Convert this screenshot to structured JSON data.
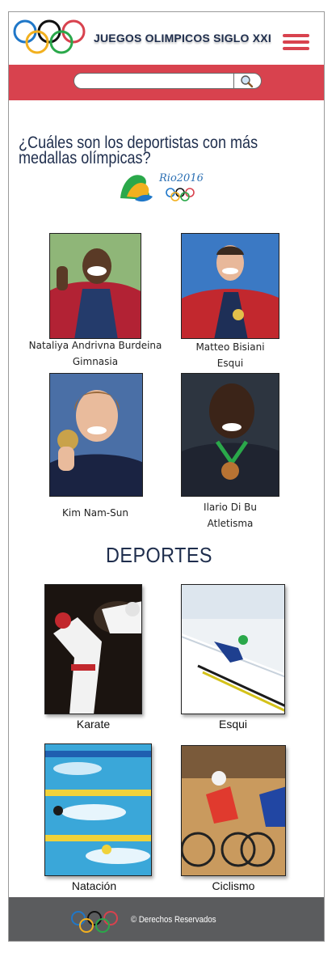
{
  "header": {
    "title": "JUEGOS OLIMPICOS SIGLO XXI",
    "logo_icon": "olympic-rings-icon",
    "menu_icon": "hamburger-menu-icon"
  },
  "search": {
    "value": "",
    "button_icon": "magnifier-search-icon"
  },
  "question": "¿Cuáles son los deportistas con más medallas olímpicas?",
  "rio_logo": {
    "text": "Rio2016"
  },
  "athletes": [
    {
      "name": "Nataliya Andrivna Burdeina",
      "sport": "Gimnasia"
    },
    {
      "name": "Matteo Bisiani",
      "sport": "Esqui"
    },
    {
      "name": "Kim Nam-Sun",
      "sport": ""
    },
    {
      "name": "Ilario Di Bu",
      "sport": "Atletisma"
    }
  ],
  "sports_section": {
    "title": "DEPORTES",
    "items": [
      {
        "label": "Karate"
      },
      {
        "label": "Esqui"
      },
      {
        "label": "Natación"
      },
      {
        "label": "Ciclismo"
      }
    ]
  },
  "footer": {
    "copyright_text": "©  Derechos Reservados"
  },
  "colors": {
    "accent_red": "#d8424e",
    "title_navy": "#1f2e4d",
    "footer_gray": "#5b5c5e"
  }
}
